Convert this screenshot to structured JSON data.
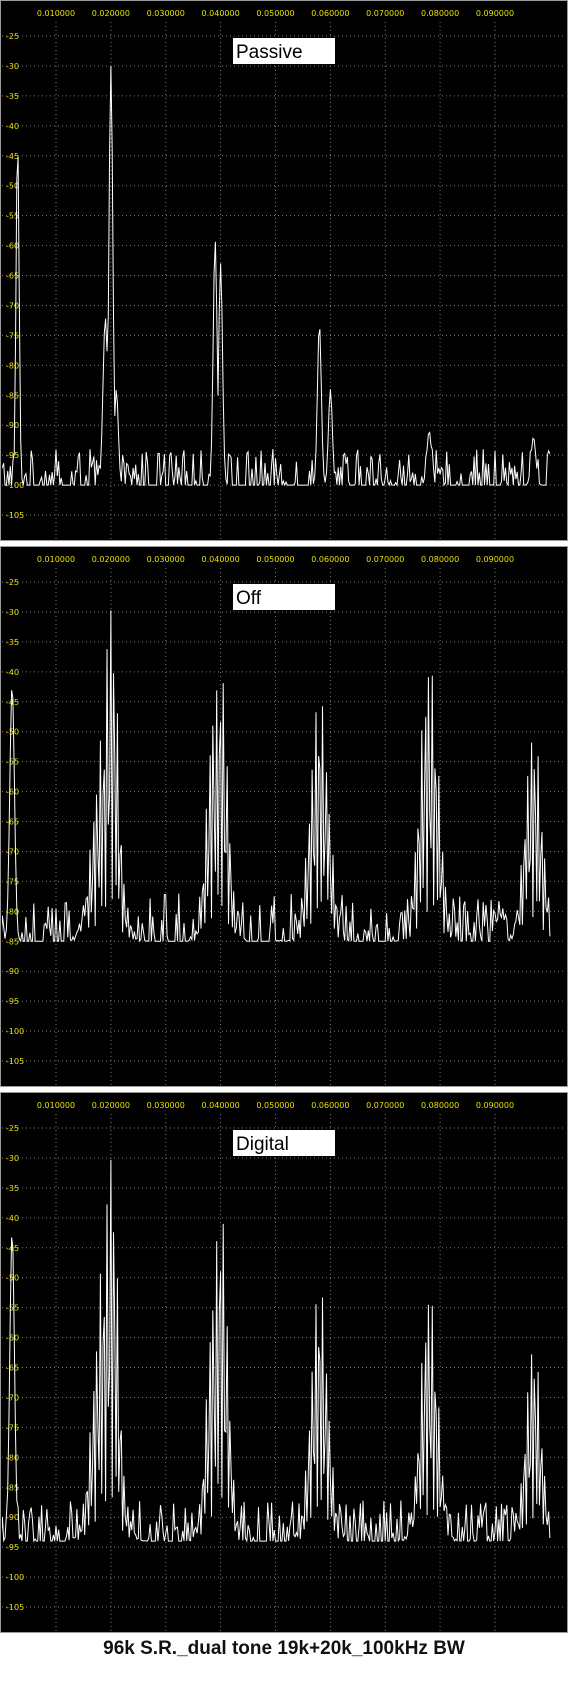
{
  "colors": {
    "background": "#000000",
    "grid": "#7a7a7a",
    "tick_text": "#e8e000",
    "trace": "#ffffff",
    "label_box": "#ffffff",
    "label_text": "#000000"
  },
  "caption": "96k S.R._dual tone 19k+20k_100kHz BW",
  "chart_data": [
    {
      "type": "line",
      "title": "Passive",
      "x_tick_labels": [
        "0.010000",
        "0.020000",
        "0.030000",
        "0.040000",
        "0.050000",
        "0.060000",
        "0.070000",
        "0.080000",
        "0.090000"
      ],
      "y_tick_labels": [
        "-25",
        "-30",
        "-35",
        "-40",
        "-45",
        "-50",
        "-55",
        "-60",
        "-65",
        "-70",
        "-75",
        "-80",
        "-85",
        "-90",
        "-95",
        "-100",
        "-105"
      ],
      "xlim": [
        0.0,
        0.1
      ],
      "ylim": [
        -108,
        -22
      ],
      "grid": true,
      "noise_floor": -100,
      "noise_amplitude": 6,
      "peaks": [
        {
          "x": 0.003,
          "y": -42,
          "width": 0.0004
        },
        {
          "x": 0.019,
          "y": -72,
          "width": 0.0006
        },
        {
          "x": 0.02,
          "y": -30,
          "width": 0.0005
        },
        {
          "x": 0.021,
          "y": -84,
          "width": 0.0005
        },
        {
          "x": 0.039,
          "y": -59,
          "width": 0.0005
        },
        {
          "x": 0.04,
          "y": -63,
          "width": 0.0005
        },
        {
          "x": 0.058,
          "y": -73,
          "width": 0.0005
        },
        {
          "x": 0.06,
          "y": -84,
          "width": 0.0005
        },
        {
          "x": 0.078,
          "y": -91,
          "width": 0.0006
        },
        {
          "x": 0.097,
          "y": -92,
          "width": 0.0006
        }
      ]
    },
    {
      "type": "line",
      "title": "Off",
      "x_tick_labels": [
        "0.010000",
        "0.020000",
        "0.030000",
        "0.040000",
        "0.050000",
        "0.060000",
        "0.070000",
        "0.080000",
        "0.090000"
      ],
      "y_tick_labels": [
        "-25",
        "-30",
        "-35",
        "-40",
        "-45",
        "-50",
        "-55",
        "-60",
        "-65",
        "-70",
        "-75",
        "-80",
        "-85",
        "-90",
        "-95",
        "-100",
        "-105"
      ],
      "xlim": [
        0.0,
        0.1
      ],
      "ylim": [
        -108,
        -22
      ],
      "grid": true,
      "noise_floor": -85,
      "noise_amplitude": 8,
      "peaks": [
        {
          "x": 0.002,
          "y": -42,
          "width": 0.0006
        },
        {
          "x": 0.019,
          "y": -48,
          "width": 0.003
        },
        {
          "x": 0.02,
          "y": -26,
          "width": 0.0018
        },
        {
          "x": 0.039,
          "y": -42,
          "width": 0.002
        },
        {
          "x": 0.04,
          "y": -37,
          "width": 0.0018
        },
        {
          "x": 0.058,
          "y": -43,
          "width": 0.0024
        },
        {
          "x": 0.078,
          "y": -37,
          "width": 0.0024
        },
        {
          "x": 0.097,
          "y": -49,
          "width": 0.0022
        }
      ]
    },
    {
      "type": "line",
      "title": "Digital",
      "x_tick_labels": [
        "0.010000",
        "0.020000",
        "0.030000",
        "0.040000",
        "0.050000",
        "0.060000",
        "0.070000",
        "0.080000",
        "0.090000"
      ],
      "y_tick_labels": [
        "-25",
        "-30",
        "-35",
        "-40",
        "-45",
        "-50",
        "-55",
        "-60",
        "-65",
        "-70",
        "-75",
        "-80",
        "-85",
        "-90",
        "-95",
        "-100",
        "-105"
      ],
      "xlim": [
        0.0,
        0.1
      ],
      "ylim": [
        -108,
        -22
      ],
      "grid": true,
      "noise_floor": -94,
      "noise_amplitude": 7,
      "peaks": [
        {
          "x": 0.002,
          "y": -42,
          "width": 0.0006
        },
        {
          "x": 0.019,
          "y": -44,
          "width": 0.0028
        },
        {
          "x": 0.02,
          "y": -26,
          "width": 0.0018
        },
        {
          "x": 0.039,
          "y": -48,
          "width": 0.002
        },
        {
          "x": 0.04,
          "y": -35,
          "width": 0.0018
        },
        {
          "x": 0.058,
          "y": -50,
          "width": 0.0022
        },
        {
          "x": 0.078,
          "y": -51,
          "width": 0.0022
        },
        {
          "x": 0.097,
          "y": -60,
          "width": 0.002
        }
      ]
    }
  ]
}
